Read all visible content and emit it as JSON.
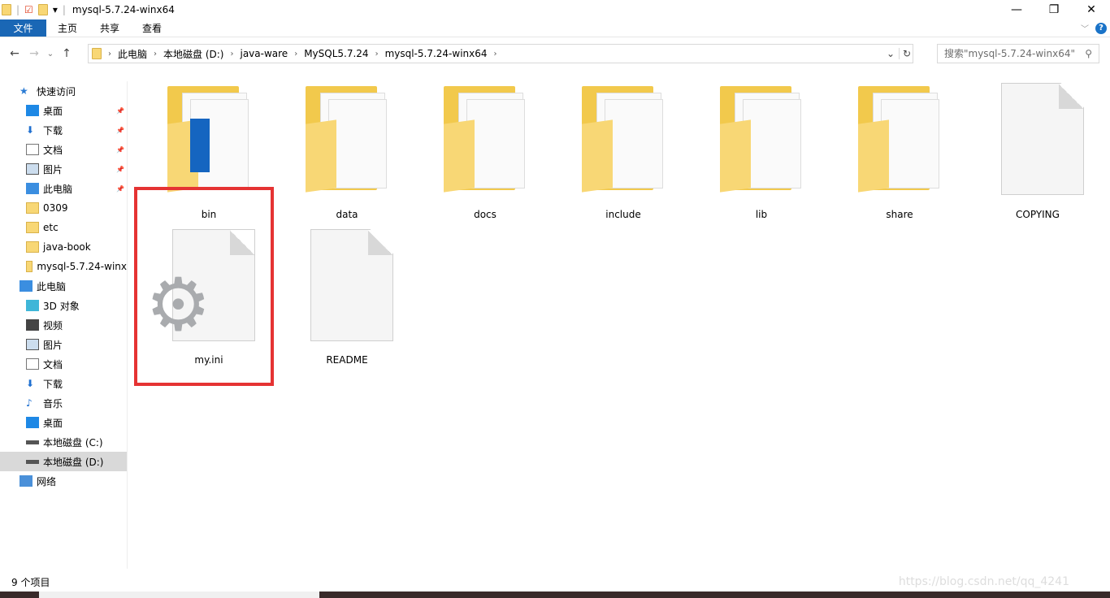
{
  "window": {
    "title": "mysql-5.7.24-winx64"
  },
  "ribbon": {
    "tabs": [
      "文件",
      "主页",
      "共享",
      "查看"
    ]
  },
  "address": {
    "crumbs": [
      "此电脑",
      "本地磁盘 (D:)",
      "java-ware",
      "MySQL5.7.24",
      "mysql-5.7.24-winx64"
    ]
  },
  "search": {
    "placeholder": "搜索\"mysql-5.7.24-winx64\""
  },
  "sidebar": {
    "items": [
      {
        "label": "快速访问",
        "icon": "star-icon",
        "level": 0
      },
      {
        "label": "桌面",
        "icon": "desktop-icon",
        "level": 1,
        "pinned": true
      },
      {
        "label": "下载",
        "icon": "download-icon",
        "level": 1,
        "pinned": true
      },
      {
        "label": "文档",
        "icon": "document-icon",
        "level": 1,
        "pinned": true
      },
      {
        "label": "图片",
        "icon": "picture-icon",
        "level": 1,
        "pinned": true
      },
      {
        "label": "此电脑",
        "icon": "computer-icon",
        "level": 1,
        "pinned": true
      },
      {
        "label": "0309",
        "icon": "folder-icon",
        "level": 1
      },
      {
        "label": "etc",
        "icon": "folder-icon",
        "level": 1
      },
      {
        "label": "java-book",
        "icon": "folder-icon",
        "level": 1
      },
      {
        "label": "mysql-5.7.24-winx",
        "icon": "folder-icon",
        "level": 1
      },
      {
        "label": "此电脑",
        "icon": "computer-icon",
        "level": 0
      },
      {
        "label": "3D 对象",
        "icon": "cube-icon",
        "level": 1
      },
      {
        "label": "视频",
        "icon": "video-icon",
        "level": 1
      },
      {
        "label": "图片",
        "icon": "picture-icon",
        "level": 1
      },
      {
        "label": "文档",
        "icon": "document-icon",
        "level": 1
      },
      {
        "label": "下载",
        "icon": "download-icon",
        "level": 1
      },
      {
        "label": "音乐",
        "icon": "music-icon",
        "level": 1
      },
      {
        "label": "桌面",
        "icon": "desktop-icon",
        "level": 1
      },
      {
        "label": "本地磁盘 (C:)",
        "icon": "drive-icon",
        "level": 1
      },
      {
        "label": "本地磁盘 (D:)",
        "icon": "drive-icon",
        "level": 1,
        "selected": true
      },
      {
        "label": "网络",
        "icon": "network-icon",
        "level": 0
      }
    ]
  },
  "files": [
    {
      "name": "bin",
      "type": "folder"
    },
    {
      "name": "data",
      "type": "folder"
    },
    {
      "name": "docs",
      "type": "folder"
    },
    {
      "name": "include",
      "type": "folder"
    },
    {
      "name": "lib",
      "type": "folder"
    },
    {
      "name": "share",
      "type": "folder"
    },
    {
      "name": "COPYING",
      "type": "file"
    },
    {
      "name": "my.ini",
      "type": "settings-file",
      "highlighted": true
    },
    {
      "name": "README",
      "type": "file"
    }
  ],
  "status": {
    "count": "9 个项目"
  },
  "watermark": "https://blog.csdn.net/qq_4241",
  "colors": {
    "accent": "#1a67b5",
    "highlight": "#e53333"
  }
}
